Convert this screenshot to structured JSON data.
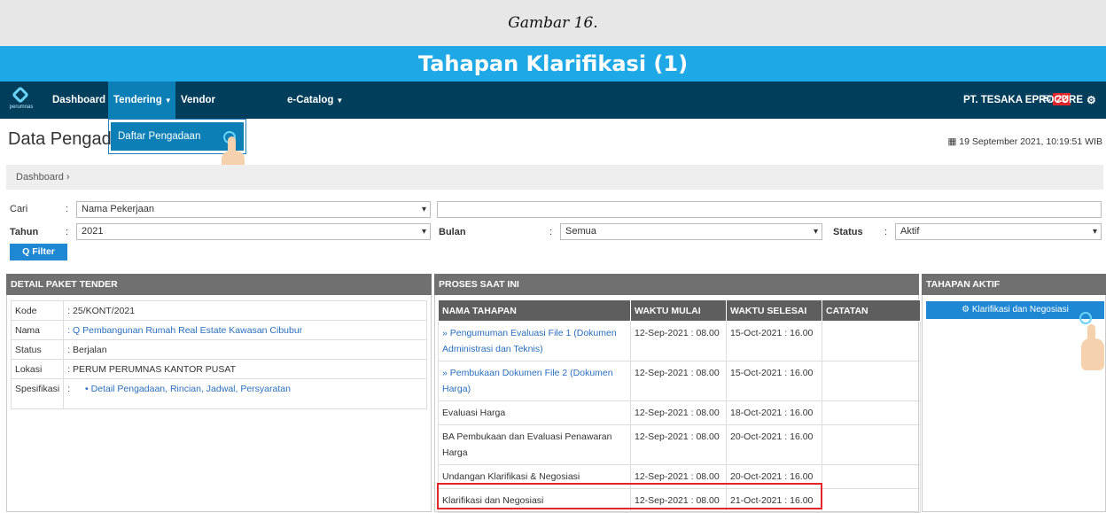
{
  "caption": {
    "figure": "Gambar 16.",
    "title": "Tahapan Klarifikasi (1)"
  },
  "navbar": {
    "logo_text": "perumnas",
    "items": [
      {
        "label": "Dashboard"
      },
      {
        "label": "Tendering"
      },
      {
        "label": "Vendor Management"
      },
      {
        "label": "e-Catalog"
      }
    ],
    "notification_count": "22",
    "company": "PT. TESAKA EPROCURE"
  },
  "dropdown": {
    "item": "Daftar Pengadaan"
  },
  "page": {
    "title": "Data Pengad",
    "datetime": "19 September 2021, 10:19:51 WIB",
    "breadcrumb": "Dashboard ›"
  },
  "filters": {
    "cari_label": "Cari",
    "cari_value": "Nama Pekerjaan",
    "tahun_label": "Tahun",
    "tahun_value": "2021",
    "bulan_label": "Bulan",
    "bulan_value": "Semua",
    "status_label": "Status",
    "status_value": "Aktif",
    "filter_button": "Q Filter"
  },
  "detail": {
    "heading": "DETAIL PAKET TENDER",
    "rows": [
      {
        "key": "Kode",
        "value": ": 25/KONT/2021"
      },
      {
        "key": "Nama",
        "value": ": Q Pembangunan Rumah Real Estate Kawasan Cibubur"
      },
      {
        "key": "Status",
        "value": ": Berjalan"
      },
      {
        "key": "Lokasi",
        "value": ": PERUM PERUMNAS KANTOR PUSAT"
      },
      {
        "key": "Spesifikasi",
        "value": ":",
        "link": "• Detail Pengadaan, Rincian, Jadwal, Persyaratan"
      }
    ]
  },
  "proses": {
    "heading": "PROSES SAAT INI",
    "columns": [
      "NAMA TAHAPAN",
      "WAKTU MULAI",
      "WAKTU SELESAI",
      "CATATAN"
    ],
    "rows": [
      {
        "nama": "» Pengumuman Evaluasi File 1 (Dokumen Administrasi dan Teknis)",
        "mulai": "12-Sep-2021 : 08.00",
        "selesai": "15-Oct-2021 : 16.00",
        "catatan": ""
      },
      {
        "nama": "» Pembukaan Dokumen File 2 (Dokumen Harga)",
        "mulai": "12-Sep-2021 : 08.00",
        "selesai": "15-Oct-2021 : 16.00",
        "catatan": ""
      },
      {
        "nama": "Evaluasi Harga",
        "mulai": "12-Sep-2021 : 08.00",
        "selesai": "18-Oct-2021 : 16.00",
        "catatan": ""
      },
      {
        "nama": "BA Pembukaan dan Evaluasi Penawaran Harga",
        "mulai": "12-Sep-2021 : 08.00",
        "selesai": "20-Oct-2021 : 16.00",
        "catatan": ""
      },
      {
        "nama": "Undangan Klarifikasi & Negosiasi",
        "mulai": "12-Sep-2021 : 08.00",
        "selesai": "20-Oct-2021 : 16.00",
        "catatan": ""
      },
      {
        "nama": "Klarifikasi dan Negosiasi",
        "mulai": "12-Sep-2021 : 08.00",
        "selesai": "21-Oct-2021 : 16.00",
        "catatan": ""
      }
    ]
  },
  "tahapan": {
    "heading": "TAHAPAN AKTIF",
    "button": "Klarifikasi dan Negosiasi"
  },
  "colors": {
    "navbar": "#003e5c",
    "active_nav": "#0b7fb6",
    "caption_blue": "#1ea9e6",
    "highlight": "#e2262b"
  }
}
